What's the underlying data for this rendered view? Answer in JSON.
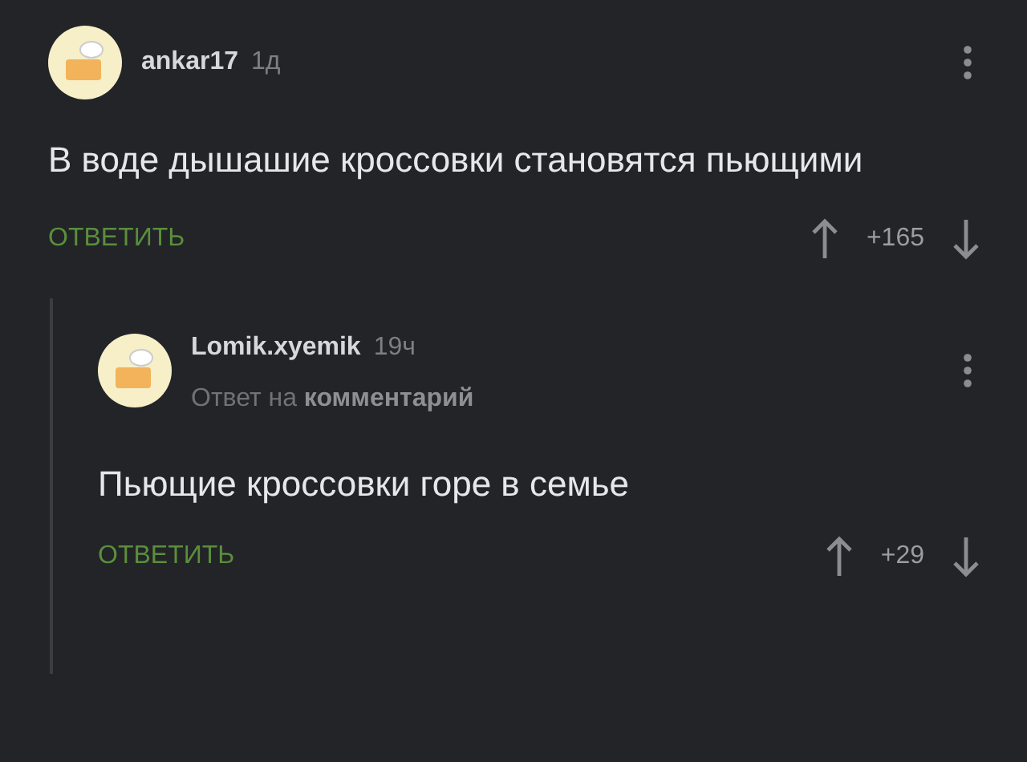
{
  "comments": [
    {
      "author": "ankar17",
      "time": "1д",
      "text": "В воде дышашие кроссовки становятся пьющими",
      "reply_button": "ОТВЕТИТЬ",
      "rating": "+165",
      "children": [
        {
          "author": "Lomik.xyemik",
          "time": "19ч",
          "reply_to": "Ответ на **комментарий**",
          "text": "Пьющие кроссовки горе в семье",
          "reply_button": "ОТВЕТИТЬ",
          "rating": "+29"
        }
      ]
    }
  ]
}
